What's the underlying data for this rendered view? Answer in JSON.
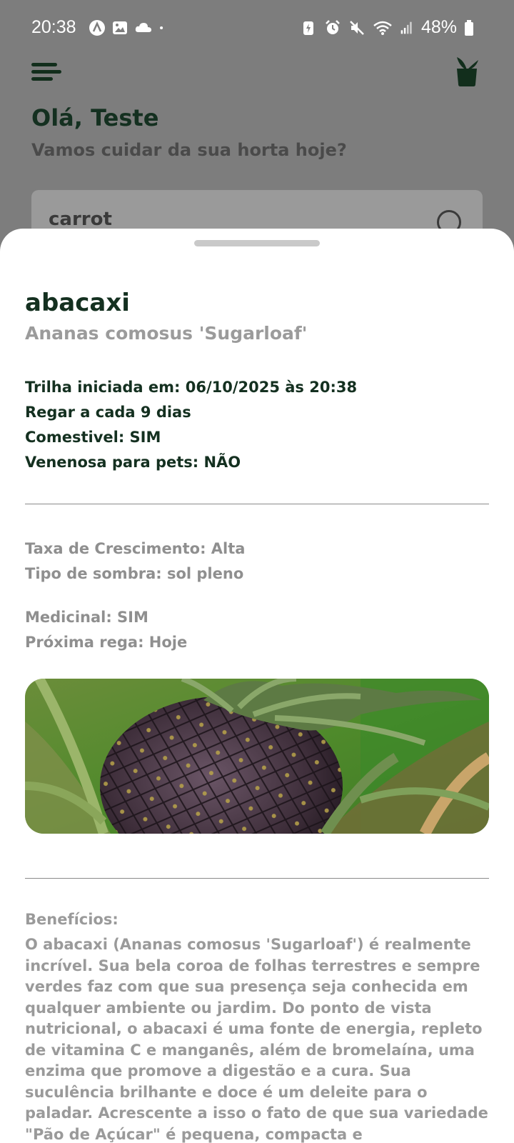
{
  "status_bar": {
    "time": "20:38",
    "battery": "48%",
    "left_icons": [
      "a-circle-icon",
      "image-icon",
      "cloud-icon",
      "dot-icon"
    ],
    "right_icons": [
      "battery-saver-icon",
      "alarm-icon",
      "mute-icon",
      "wifi-icon",
      "signal-icon",
      "battery-icon"
    ]
  },
  "header": {
    "greeting": "Olá, Teste",
    "subtitle": "Vamos cuidar da sua horta hoje?"
  },
  "search": {
    "value": "carrot"
  },
  "sheet": {
    "name": "abacaxi",
    "scientific_name": "Ananas comosus 'Sugarloaf'",
    "info": [
      "Trilha iniciada em: 06/10/2025 às 20:38",
      "Regar a cada 9 dias",
      "Comestivel: SIM",
      "Venenosa para pets: NÃO"
    ],
    "details": {
      "growth_rate": "Taxa de Crescimento: Alta",
      "shade_type": "Tipo de sombra: sol pleno",
      "medicinal": "Medicinal: SIM",
      "next_watering": "Próxima rega: Hoje"
    },
    "benefits_title": "Benefícios:",
    "benefits_text": "O abacaxi (Ananas comosus 'Sugarloaf') é realmente incrível. Sua bela coroa de folhas terrestres e sempre verdes faz com que sua presença seja conhecida em qualquer ambiente ou jardim. Do ponto de vista nutricional, o abacaxi é uma fonte de energia, repleto de vitamina C e manganês, além de bromelaína, uma enzima que promove a digestão e a cura. Sua suculência brilhante e doce é um deleite para o paladar. Acrescente a isso o fato de que sua variedade \"Pão de Açúcar\" é pequena, compacta e"
  },
  "colors": {
    "dark_green": "#143020",
    "muted_gray": "#9a9a9a",
    "scrim": "#7d7d7d"
  }
}
